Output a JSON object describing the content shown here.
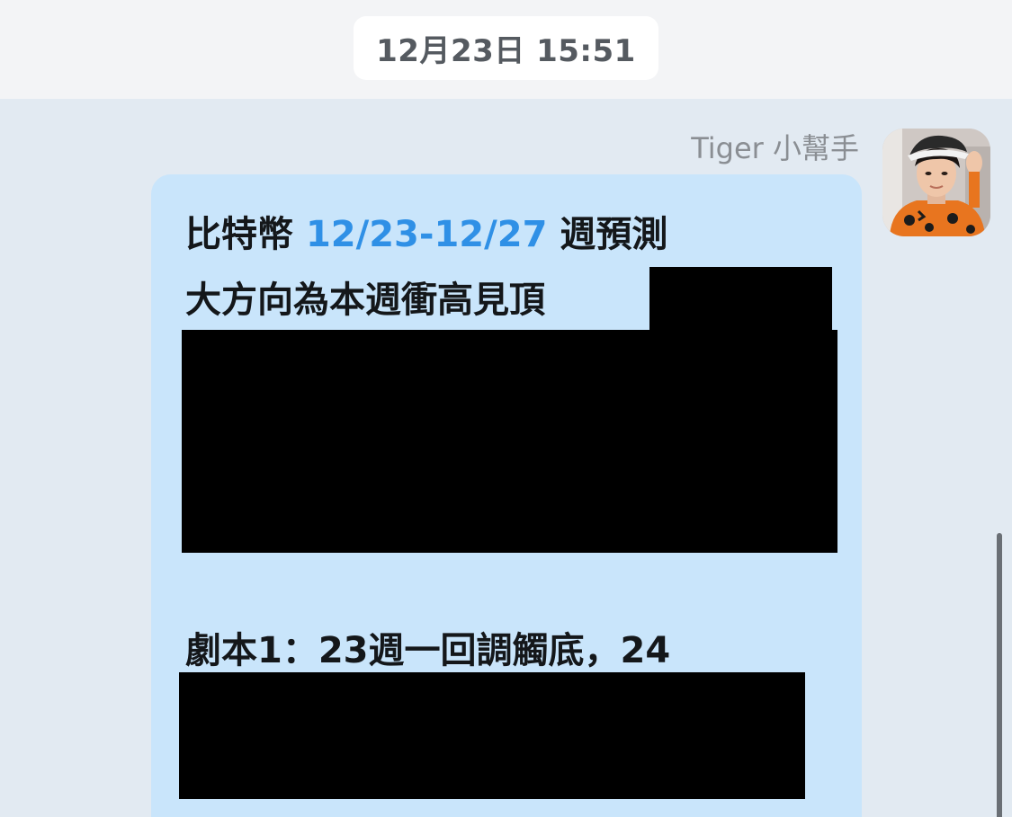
{
  "header": {
    "timestamp": "12月23日 15:51"
  },
  "message": {
    "sender_name": "Tiger 小幫手",
    "avatar_icon": "profile-photo-avatar",
    "line1_prefix": "比特幣 ",
    "line1_highlight": "12/23-12/27",
    "line1_suffix": " 週預測",
    "line2": "大方向為本週衝高見頂",
    "line3": "劇本1：23週一回調觸底，24"
  },
  "colors": {
    "background": "#e2eaf2",
    "bubble": "#c9e5fb",
    "accent": "#2f90e6",
    "text": "#14171a"
  }
}
